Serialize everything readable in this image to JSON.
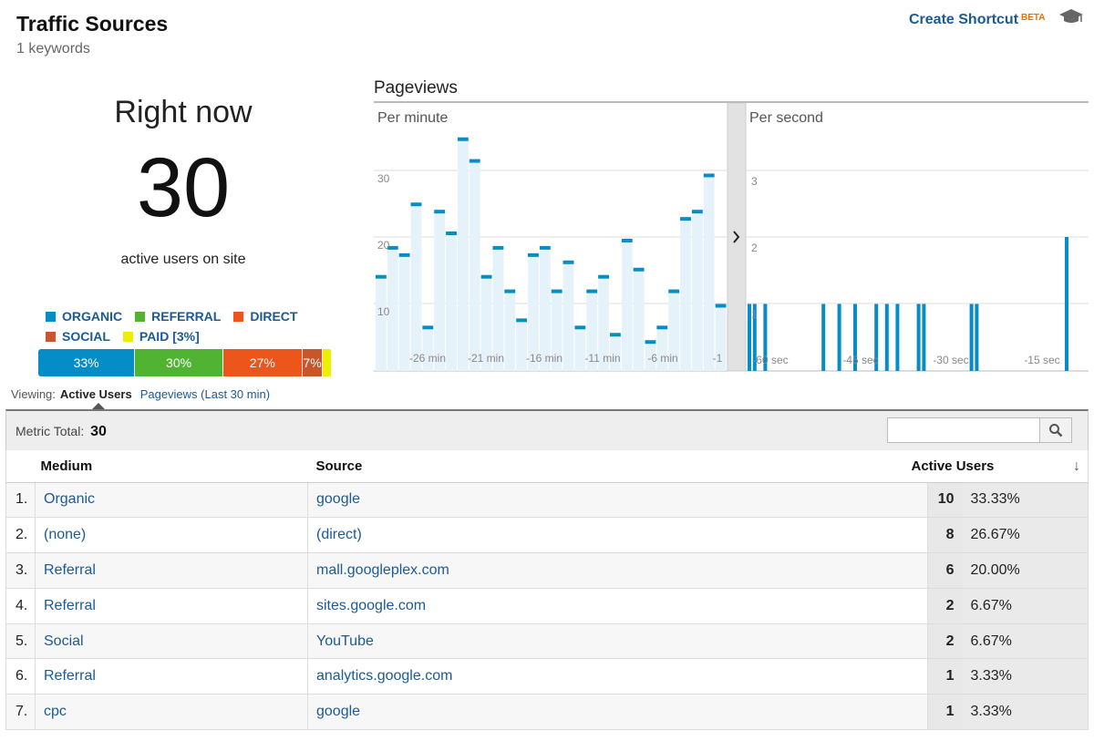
{
  "header": {
    "title": "Traffic Sources",
    "subtitle": "1 keywords",
    "shortcut_label": "Create Shortcut",
    "shortcut_badge": "BETA"
  },
  "right_now": {
    "title": "Right now",
    "count": "30",
    "label": "active users on site"
  },
  "legend": [
    {
      "label": "ORGANIC",
      "color": "#058dc7"
    },
    {
      "label": "REFERRAL",
      "color": "#50b432"
    },
    {
      "label": "DIRECT",
      "color": "#ed561b"
    },
    {
      "label": "SOCIAL",
      "color": "#c9552a"
    },
    {
      "label": "PAID [3%]",
      "color": "#edef00"
    }
  ],
  "share_bar": [
    {
      "label": "33%",
      "value": 33,
      "color": "#058dc7"
    },
    {
      "label": "30%",
      "value": 30,
      "color": "#50b432"
    },
    {
      "label": "27%",
      "value": 27,
      "color": "#ed561b"
    },
    {
      "label": "7%",
      "value": 7,
      "color": "#c9552a"
    },
    {
      "label": "",
      "value": 3,
      "color": "#edef00"
    }
  ],
  "viewing": {
    "label": "Viewing:",
    "active": "Active Users",
    "other": "Pageviews (Last 30 min)"
  },
  "chart_data": [
    {
      "type": "bar",
      "title": "Pageviews",
      "panel_label": "Per minute",
      "y_ticks": [
        "30",
        "20",
        "10"
      ],
      "ylim": [
        0,
        37
      ],
      "x_tick_labels": [
        "-26 min",
        "-21 min",
        "-16 min",
        "-11 min",
        "-6 min",
        "-1"
      ],
      "values": [
        13,
        17,
        16,
        23,
        6,
        22,
        19,
        32,
        29,
        13,
        17,
        11,
        7,
        16,
        17,
        11,
        15,
        6,
        11,
        13,
        5,
        18,
        14,
        4,
        6,
        11,
        21,
        22,
        27,
        9
      ],
      "color": "#058dc7",
      "fill": "#e6f2fa"
    },
    {
      "type": "bar",
      "panel_label": "Per second",
      "y_ticks": [
        "3",
        "2",
        "1"
      ],
      "ylim": [
        0,
        4
      ],
      "x_tick_labels": [
        "-60 sec",
        "-45 sec",
        "-30 sec",
        "-15 sec"
      ],
      "active_seconds": [
        -60,
        -59,
        -57,
        -46,
        -43,
        -40,
        -36,
        -34,
        -32,
        -28,
        -27,
        -18,
        -17
      ],
      "values": [
        1,
        1,
        1,
        1,
        1,
        1,
        1,
        1,
        1,
        1,
        1,
        1,
        1
      ],
      "last_second_value": 2,
      "color": "#058dc7"
    }
  ],
  "metric": {
    "label": "Metric Total:",
    "value": "30"
  },
  "table": {
    "headers": {
      "medium": "Medium",
      "source": "Source",
      "active_users": "Active Users"
    },
    "rows": [
      {
        "index": "1.",
        "medium": "Organic",
        "source": "google",
        "value": "10",
        "pct": "33.33%"
      },
      {
        "index": "2.",
        "medium": "(none)",
        "source": "(direct)",
        "value": "8",
        "pct": "26.67%"
      },
      {
        "index": "3.",
        "medium": "Referral",
        "source": "mall.googleplex.com",
        "value": "6",
        "pct": "20.00%"
      },
      {
        "index": "4.",
        "medium": "Referral",
        "source": "sites.google.com",
        "value": "2",
        "pct": "6.67%"
      },
      {
        "index": "5.",
        "medium": "Social",
        "source": "YouTube",
        "value": "2",
        "pct": "6.67%"
      },
      {
        "index": "6.",
        "medium": "Referral",
        "source": "analytics.google.com",
        "value": "1",
        "pct": "3.33%"
      },
      {
        "index": "7.",
        "medium": "cpc",
        "source": "google",
        "value": "1",
        "pct": "3.33%"
      }
    ]
  }
}
